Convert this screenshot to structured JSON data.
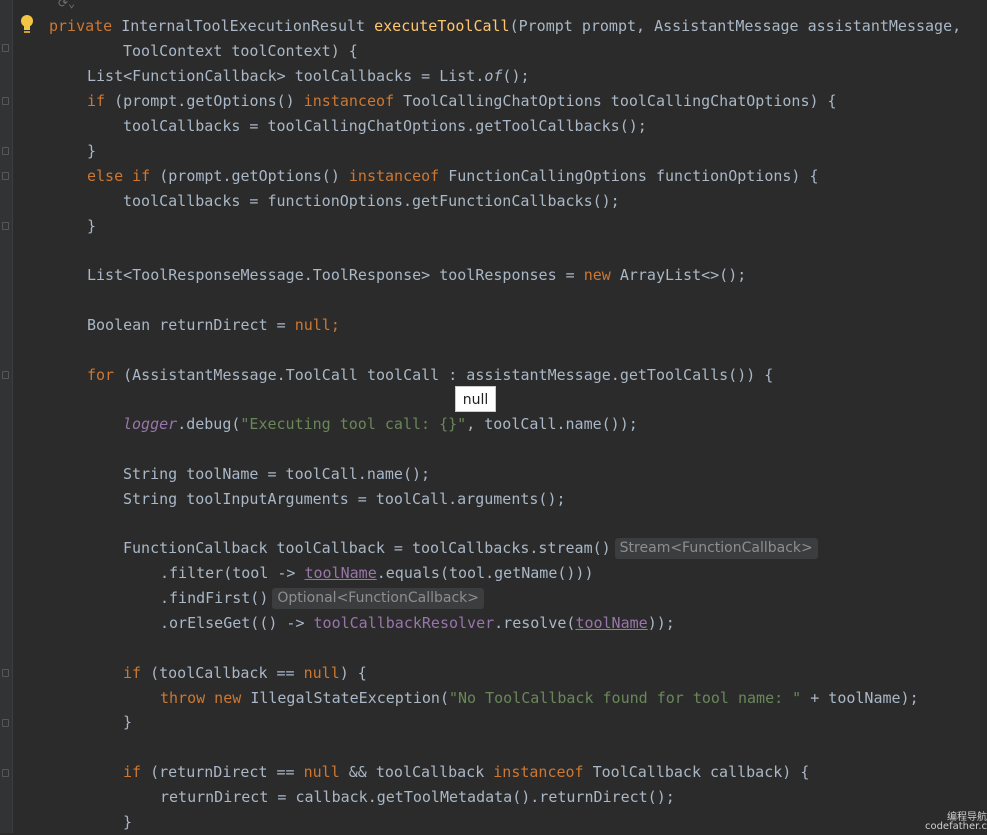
{
  "tooltip": "null",
  "hints": {
    "stream": "Stream<FunctionCallback>",
    "optional": "Optional<FunctionCallback>"
  },
  "watermark": {
    "line1": "编程导航",
    "line2": "codefather.c"
  },
  "code": {
    "l1": {
      "kw": "private ",
      "type": "InternalToolExecutionResult ",
      "method": "executeToolCall",
      "rest": "(Prompt prompt, AssistantMessage assistantMessage,"
    },
    "l2": "ToolContext toolContext) {",
    "l3": {
      "a": "List<FunctionCallback> toolCallbacks = List.",
      "b": "of",
      "c": "();"
    },
    "l4": {
      "kw": "if ",
      "a": "(prompt.getOptions() ",
      "kw2": "instanceof ",
      "b": "ToolCallingChatOptions toolCallingChatOptions) {"
    },
    "l5": "toolCallbacks = toolCallingChatOptions.getToolCallbacks();",
    "l6": "}",
    "l7": {
      "kw": "else if ",
      "a": "(prompt.getOptions() ",
      "kw2": "instanceof ",
      "b": "FunctionCallingOptions functionOptions) {"
    },
    "l8": "toolCallbacks = functionOptions.getFunctionCallbacks();",
    "l9": "}",
    "l10": {
      "a": "List<ToolResponseMessage.ToolResponse> toolResponses = ",
      "kw": "new ",
      "b": "ArrayList<>();"
    },
    "l11": {
      "a": "Boolean returnDirect = ",
      "kw": "null;"
    },
    "l12": {
      "kw": "for ",
      "a": "(AssistantMessage.ToolCall toolCall : assistantMessage.getToolCalls()) {"
    },
    "l13": {
      "fld": "logger",
      "a": ".debug(",
      "str": "\"Executing tool call: {}\"",
      "b": ", toolCall.name());"
    },
    "l14": "String toolName = toolCall.name();",
    "l15": "String toolInputArguments = toolCall.arguments();",
    "l16": "FunctionCallback toolCallback = toolCallbacks.stream()",
    "l17": {
      "a": ".filter(tool -> ",
      "var": "toolName",
      "b": ".equals(tool.getName()))"
    },
    "l18": ".findFirst()",
    "l19": {
      "a": ".orElseGet(() -> ",
      "fld": "toolCallbackResolver",
      "b": ".resolve(",
      "var": "toolName",
      "c": "));"
    },
    "l20": {
      "kw": "if ",
      "a": "(toolCallback == ",
      "kw2": "null",
      "b": ") {"
    },
    "l21": {
      "kw": "throw new ",
      "a": "IllegalStateException(",
      "str": "\"No ToolCallback found for tool name: \"",
      "b": " + toolName);"
    },
    "l22": "}",
    "l23": {
      "kw": "if ",
      "a": "(returnDirect == ",
      "kw2": "null ",
      "b": "&& toolCallback ",
      "kw3": "instanceof ",
      "c": "ToolCallback callback) {"
    },
    "l24": "returnDirect = callback.getToolMetadata().returnDirect();",
    "l25": "}"
  },
  "colors": {
    "background": "#2b2b2b",
    "keyword": "#cc7832",
    "method": "#ffc66d",
    "string": "#6a8759",
    "field": "#9876aa",
    "text": "#a9b7c6"
  }
}
